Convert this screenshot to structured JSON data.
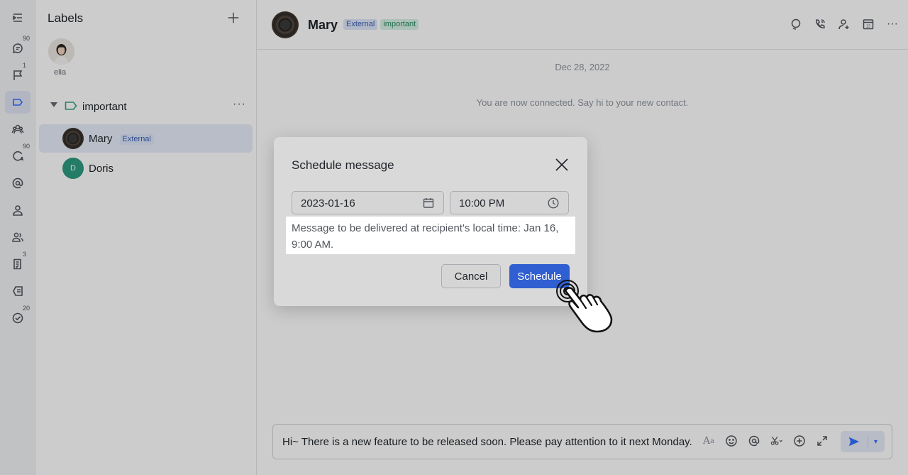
{
  "rail": {
    "items": [
      {
        "name": "collapse",
        "badge": ""
      },
      {
        "name": "chats",
        "badge": "90"
      },
      {
        "name": "flagged",
        "badge": "1"
      },
      {
        "name": "labels",
        "badge": ""
      },
      {
        "name": "groups",
        "badge": ""
      },
      {
        "name": "threads",
        "badge": "90"
      },
      {
        "name": "mentions",
        "badge": ""
      },
      {
        "name": "contacts",
        "badge": ""
      },
      {
        "name": "team",
        "badge": ""
      },
      {
        "name": "tasks",
        "badge": "3"
      },
      {
        "name": "docs",
        "badge": ""
      },
      {
        "name": "todo",
        "badge": "20"
      }
    ]
  },
  "panel": {
    "title": "Labels",
    "user_name": "elia",
    "group": {
      "label": "important"
    },
    "contacts": [
      {
        "name": "Mary",
        "tag": "External",
        "initial": ""
      },
      {
        "name": "Doris",
        "tag": "",
        "initial": "D"
      }
    ]
  },
  "chat": {
    "name": "Mary",
    "tags": [
      "External",
      "important"
    ],
    "date": "Dec 28, 2022",
    "system_message": "You are now connected. Say hi to your new contact.",
    "composer_text": "Hi~ There is a new feature to be released soon. Please pay attention to it next Monday."
  },
  "modal": {
    "title": "Schedule message",
    "date_value": "2023-01-16",
    "time_value": "10:00 PM",
    "local_time_note": "Message to be delivered at recipient's local time: Jan 16, 9:00 AM.",
    "cancel_label": "Cancel",
    "schedule_label": "Schedule"
  },
  "colors": {
    "accent": "#3370ff",
    "schedule_button": "#2f5fd0",
    "tag_external_bg": "#dde6fa",
    "tag_important_bg": "#d6f0e5",
    "doris_avatar": "#2d9a80"
  }
}
